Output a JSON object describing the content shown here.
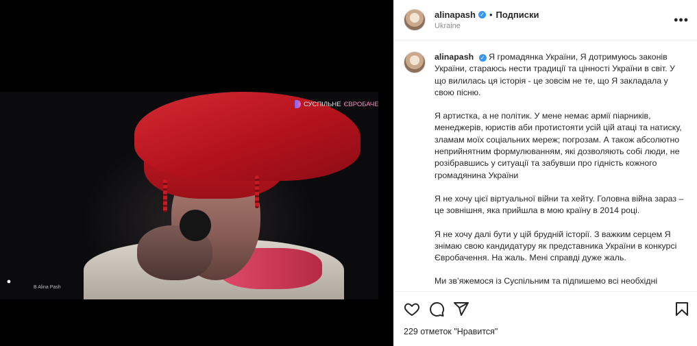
{
  "media": {
    "watermark_part1": "СУСПІЛЬНЕ",
    "watermark_part2": "ЄВРОБАЧЕННЯ",
    "credit": "B Alina Pash",
    "tag_icon": "person-icon"
  },
  "header": {
    "username": "alinapash",
    "separator": "•",
    "follow_label": "Подписки",
    "location": "Ukraine",
    "more_icon": "more-icon",
    "verified_icon": "verified-badge-icon"
  },
  "caption": {
    "username": "alinapash",
    "paragraphs": [
      "Я громадянка України, Я дотримуюсь законів України, стараюсь нести традиції та цінності України в світ. У що вилилась ця історія - це зовсім не те, що Я закладала у свою пісню.",
      "Я артистка, а не політик. У мене немає армії піарників, менеджерів, юристів аби протистояти усій цій атаці та натиску, зламам моїх соціальних мереж; погрозам. А також абсолютно неприйнятним формулюванням, які дозволяють собі люди, не розібравшись у ситуації та забувши про гідність кожного громадянина України",
      "Я не хочу цієї віртуальної війни та хейту. Головна війна зараз – це зовнішня, яка прийшла в мою країну в 2014 році.",
      "Я не хочу далі бути у цій брудній історії. З важким серцем Я знімаю свою кандидатуру як представника України в конкурсі Євробачення. На жаль. Мені справді дуже жаль.",
      "Ми зв’яжемося із Суспільним та підпишемо всі необхідні документи."
    ]
  },
  "actions": {
    "like_icon": "heart-icon",
    "comment_icon": "comment-icon",
    "share_icon": "share-icon",
    "save_icon": "bookmark-icon"
  },
  "likes_text": "229 отметок \"Нравится\"",
  "colors": {
    "verified": "#3897f0",
    "hat_red": "#c71b26",
    "text": "#262626",
    "muted": "#8e8e8e"
  }
}
